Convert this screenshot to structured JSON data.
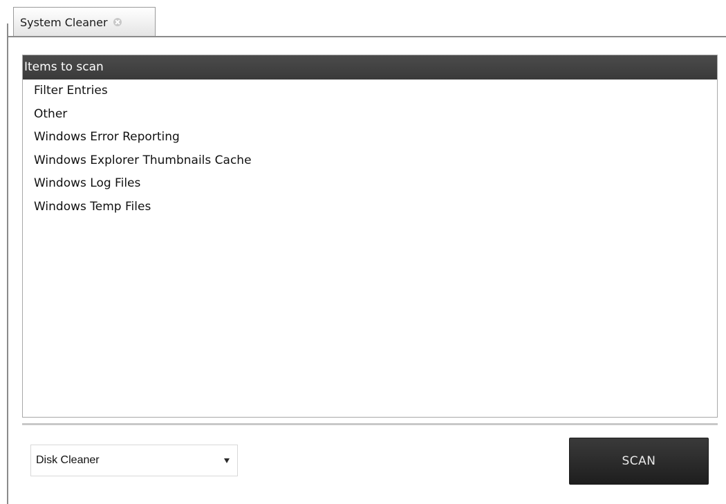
{
  "tab": {
    "label": "System Cleaner",
    "close_icon": "close-circle-icon"
  },
  "list": {
    "header": "Items to scan",
    "items": [
      "Filter Entries",
      "Other",
      "Windows Error Reporting",
      "Windows Explorer Thumbnails Cache",
      "Windows Log Files",
      "Windows Temp Files"
    ]
  },
  "controls": {
    "cleaner_select": {
      "value": "Disk Cleaner",
      "arrow_icon": "triangle-down-icon"
    },
    "scan_label": "SCAN"
  },
  "colors": {
    "header_bg": "#3f3f3f",
    "scan_button_bg": "#262626"
  }
}
